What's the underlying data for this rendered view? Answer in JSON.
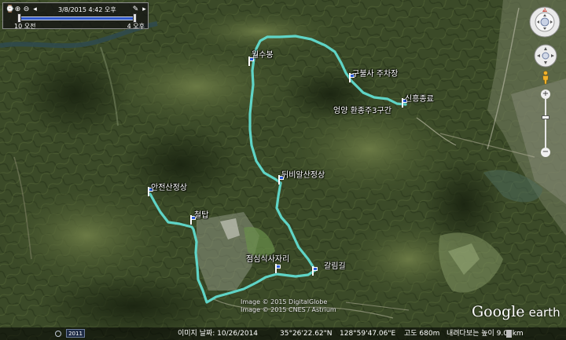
{
  "map": {
    "waypoints": [
      {
        "id": "wolsu",
        "label": "월수봉"
      },
      {
        "id": "gubulsa",
        "label": "구불사 주차장"
      },
      {
        "id": "sinheung",
        "label": "신흥종료"
      },
      {
        "id": "eonyang",
        "label": "엉양 환종주3구간"
      },
      {
        "id": "dwebi",
        "label": "뒤비알산정상"
      },
      {
        "id": "anjeon",
        "label": "안전산정상"
      },
      {
        "id": "cheoltap",
        "label": "철탑"
      },
      {
        "id": "jeomsim",
        "label": "점심식사자리"
      },
      {
        "id": "galrim",
        "label": "갈림길"
      }
    ],
    "track_color": "#5fd4c6",
    "pin_color": "#1b3fa8"
  },
  "time_slider": {
    "date": "3/8/2015",
    "time": "4:42 오후",
    "start_label": "10 오전",
    "end_label": "4 오후"
  },
  "credit": {
    "line1": "Image © 2015 DigitalGlobe",
    "line2": "Image © 2015 CNES / Astrium"
  },
  "brand": {
    "google": "Google",
    "earth": "earth"
  },
  "status_bar": {
    "year": "2011",
    "imagery_date": "이미지 날짜: 10/26/2014",
    "lat": "35°26'22.62\"N",
    "lon": "128°59'47.06\"E",
    "elevation": "고도 680m",
    "eye_alt": "내려다보는 높이 9.03km"
  },
  "nav": {
    "look_icon": "look-compass-icon",
    "move_icon": "move-joystick-icon",
    "pegman_icon": "street-view-pegman-icon",
    "zoom_in": "+",
    "zoom_out": "−"
  }
}
